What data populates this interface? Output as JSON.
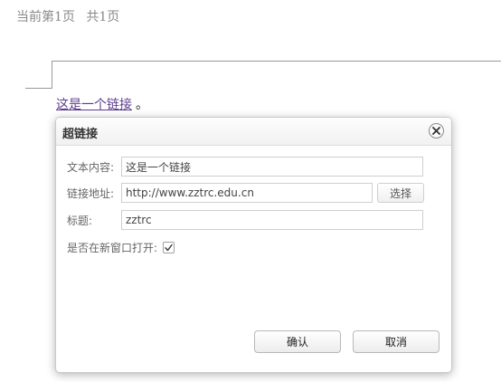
{
  "pagination": {
    "current": "当前第1页",
    "total": "共1页"
  },
  "editor": {
    "link_text": "这是一个链接",
    "trailing": "。"
  },
  "dialog": {
    "title": "超链接",
    "close_icon": "close-icon",
    "fields": {
      "text_label": "文本内容:",
      "text_value": "这是一个链接",
      "url_label": "链接地址:",
      "url_value": "http://www.zztrc.edu.cn",
      "select_label": "选择",
      "title_label": "标题:",
      "title_value": "zztrc",
      "newwin_label": "是否在新窗口打开:",
      "newwin_checked": true
    },
    "buttons": {
      "ok": "确认",
      "cancel": "取消"
    }
  },
  "colors": {
    "link": "#5b3c8c",
    "muted_text": "#888888"
  }
}
